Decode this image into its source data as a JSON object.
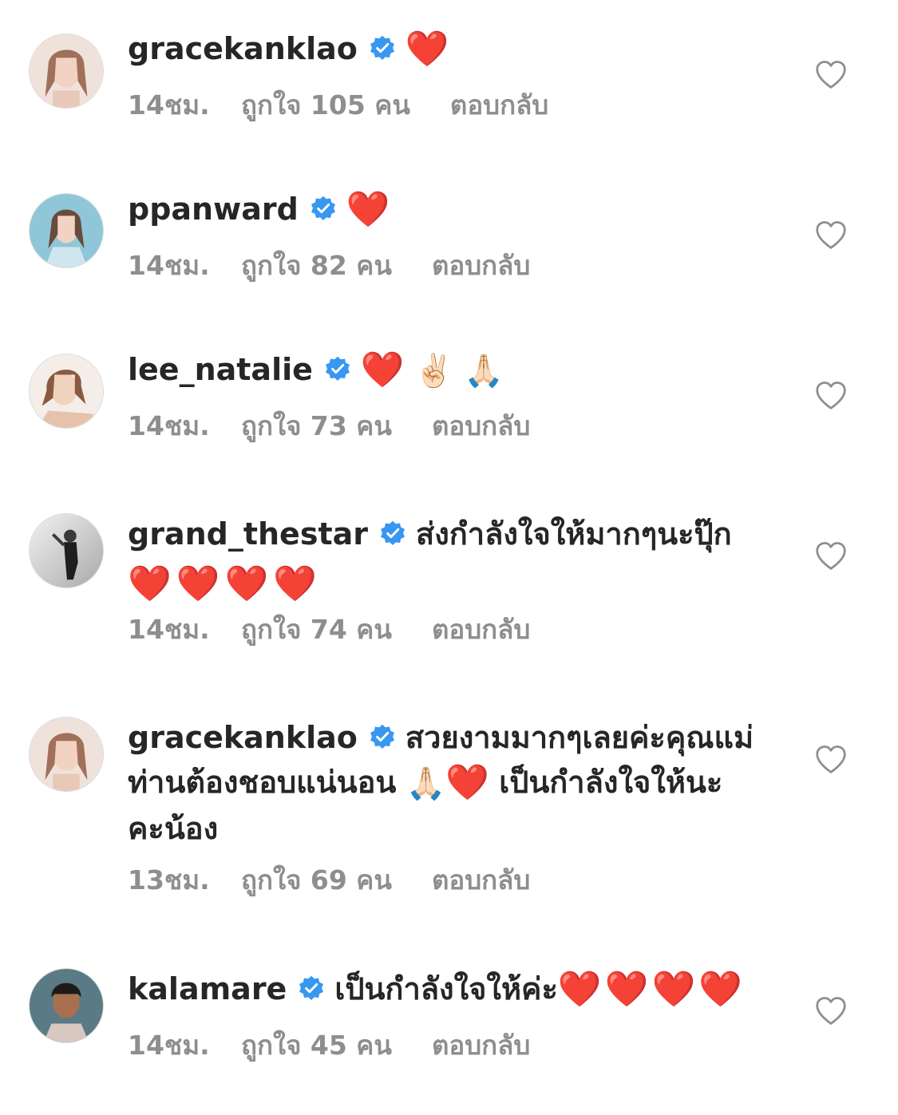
{
  "comments": [
    {
      "username": "gracekanklao",
      "text": "",
      "emoji": "❤️",
      "emoji2": "",
      "time": "14ชม.",
      "likes": "ถูกใจ 105 คน",
      "reply": "ตอบกลับ"
    },
    {
      "username": "ppanward",
      "text": "",
      "emoji": "❤️",
      "emoji2": "",
      "time": "14ชม.",
      "likes": "ถูกใจ 82 คน",
      "reply": "ตอบกลับ"
    },
    {
      "username": "lee_natalie",
      "text": "",
      "emoji": "❤️",
      "emoji2": "✌🏻 🙏🏻",
      "time": "14ชม.",
      "likes": "ถูกใจ 73 คน",
      "reply": "ตอบกลับ"
    },
    {
      "username": "grand_thestar",
      "text": "ส่งกำลังใจให้มากๆนะปุ๊ก",
      "line2_emoji": "❤️❤️❤️❤️",
      "time": "14ชม.",
      "likes": "ถูกใจ 74 คน",
      "reply": "ตอบกลับ"
    },
    {
      "username": "gracekanklao",
      "text": "สวยงามมากๆเลยค่ะคุณแม่",
      "line2_text_a": "ท่านต้องชอบแน่นอน",
      "line2_emoji_a": "🙏🏻",
      "line2_emoji_b": "❤️",
      "line2_text_b": "เป็นกำลังใจให้นะ",
      "line3_text": "คะน้อง",
      "time": "13ชม.",
      "likes": "ถูกใจ 69 คน",
      "reply": "ตอบกลับ"
    },
    {
      "username": "kalamare",
      "text": "เป็นกำลังใจให้ค่ะ",
      "emoji": "❤️❤️❤️❤️",
      "time": "14ชม.",
      "likes": "ถูกใจ 45 คน",
      "reply": "ตอบกลับ"
    }
  ],
  "icons": {
    "verified": "verified-badge-icon",
    "like": "heart-outline-icon"
  },
  "colors": {
    "verified_blue": "#3897f0",
    "meta_gray": "#8e8e8e",
    "text": "#262626",
    "heart_red": "#ed1c24"
  }
}
